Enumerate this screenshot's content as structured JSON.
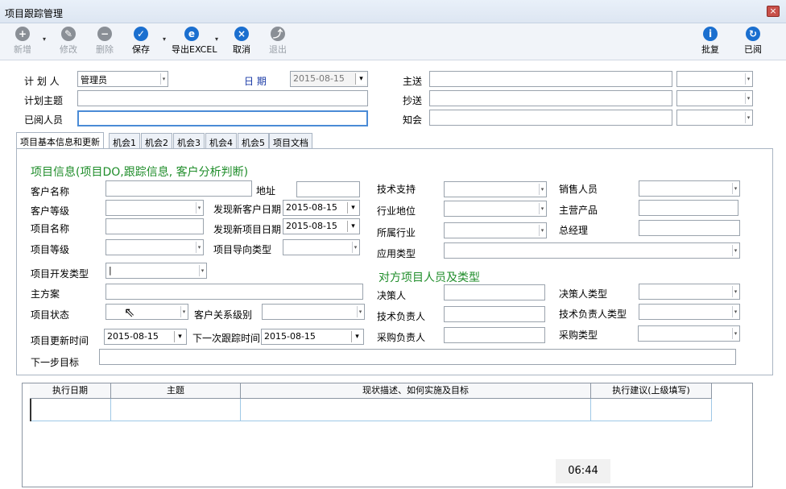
{
  "window": {
    "title": "项目跟踪管理",
    "close": "×"
  },
  "toolbar": {
    "new": "新增",
    "edit": "修改",
    "delete": "删除",
    "save": "保存",
    "export": "导出EXCEL",
    "cancel": "取消",
    "exit": "退出",
    "approve": "批复",
    "read": "已阅"
  },
  "header_form": {
    "planner_label": "计 划 人",
    "planner_value": "管理员",
    "date_label": "日  期",
    "date_value": "2015-08-15",
    "topic_label": "计划主题",
    "topic_value": "",
    "readers_label": "已阅人员",
    "readers_value": "",
    "to_label": "主送",
    "cc_label": "抄送",
    "notify_label": "知会"
  },
  "tabs": [
    "项目基本信息和更新",
    "机会1",
    "机会2",
    "机会3",
    "机会4",
    "机会5",
    "项目文档"
  ],
  "project": {
    "section_title": "项目信息(项目DO,跟踪信息, 客户分析判断)",
    "customer_name": "客户名称",
    "address": "地址",
    "customer_level": "客户等级",
    "new_customer_date": "发现新客户日期",
    "new_customer_date_value": "2015-08-15",
    "project_name": "项目名称",
    "new_project_date": "发现新项目日期",
    "new_project_date_value": "2015-08-15",
    "project_level": "项目等级",
    "project_guide_type": "项目导向类型",
    "dev_type": "项目开发类型",
    "main_plan": "主方案",
    "project_status": "项目状态",
    "customer_relation": "客户关系级别",
    "update_time": "项目更新时间",
    "update_time_value": "2015-08-15",
    "next_track_time": "下一次跟踪时间",
    "next_track_time_value": "2015-08-15",
    "next_goal": "下一步目标",
    "tech_support": "技术支持",
    "sales_person": "销售人员",
    "industry_position": "行业地位",
    "main_product": "主营产品",
    "industry": "所属行业",
    "general_manager": "总经理",
    "app_type": "应用类型"
  },
  "counterpart": {
    "section_title": "对方项目人员及类型",
    "decision_maker": "决策人",
    "decision_type": "决策人类型",
    "tech_lead": "技术负责人",
    "tech_lead_type": "技术负责人类型",
    "purchase_lead": "采购负责人",
    "purchase_type": "采购类型"
  },
  "grid": {
    "columns": [
      "执行日期",
      "主题",
      "现状描述、如何实施及目标",
      "执行建议(上级填写)"
    ]
  },
  "status": {
    "clock": "06:44"
  },
  "colors": {
    "accent_blue": "#1b6fcf",
    "section_green": "#1f8d2a",
    "label_blue": "#1a3aa6"
  }
}
